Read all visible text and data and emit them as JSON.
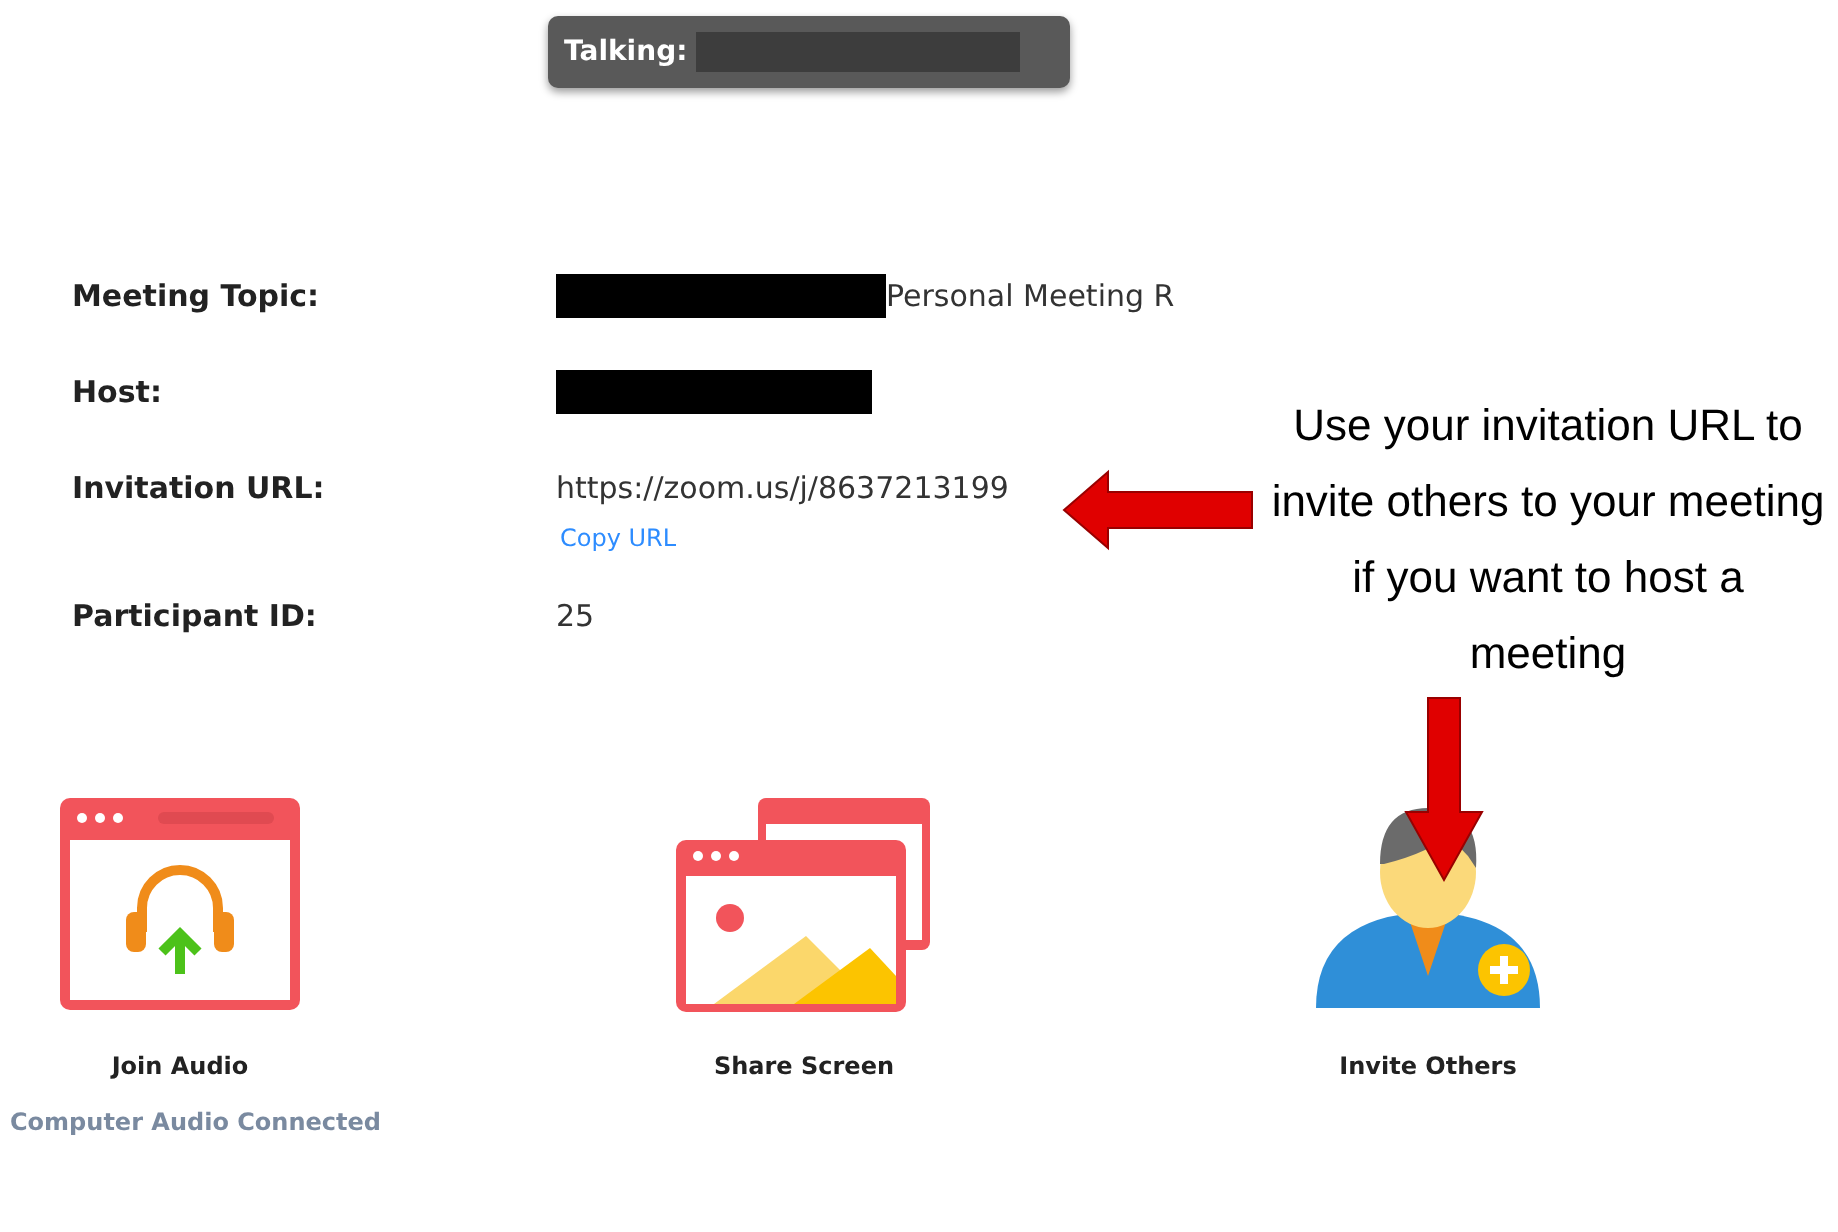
{
  "talking": {
    "label": "Talking:",
    "redacted": true
  },
  "info_rows": [
    {
      "label": "Meeting Topic:",
      "redacted": true,
      "value": "Personal Meeting R"
    },
    {
      "label": "Host:",
      "redacted": true
    },
    {
      "label": "Invitation URL:",
      "value": "https://zoom.us/j/8637213199",
      "link": "Copy URL"
    },
    {
      "label": "Participant ID:",
      "value": "25"
    }
  ],
  "actions": [
    {
      "kind": "audio",
      "label": "Join Audio"
    },
    {
      "kind": "share",
      "label": "Share Screen"
    },
    {
      "kind": "invite",
      "label": "Invite Others"
    }
  ],
  "audio_status": "Computer Audio Connected",
  "annotation": {
    "text": "Use your invitation URL to invite others to your meeting if you want to host a meeting"
  }
}
